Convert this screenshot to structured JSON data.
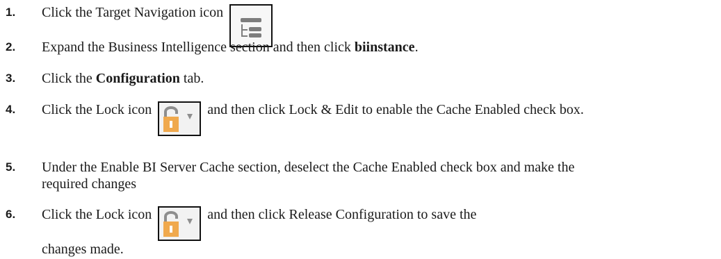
{
  "steps": [
    {
      "num": "1.",
      "text_before": "Click the Target Navigation icon",
      "icon": "target-navigation-icon"
    },
    {
      "num": "2.",
      "text_before": "Expand the Business Intelligence section and then click ",
      "bold": "biinstance",
      "text_after": "."
    },
    {
      "num": "3.",
      "text_before": "Click the ",
      "bold": "Configuration",
      "text_after": " tab."
    },
    {
      "num": "4.",
      "text_before": "Click the Lock icon",
      "icon": "lock-icon",
      "text_after": "and then click Lock & Edit to enable the Cache Enabled check box."
    },
    {
      "num": "5.",
      "text_before": "Under the Enable BI Server Cache section, deselect the Cache Enabled check box and make the required changes"
    },
    {
      "num": "6.",
      "text_before": "Click the Lock icon",
      "icon": "lock-icon",
      "text_after": "and then click Release Configuration to save the changes made."
    }
  ],
  "colors": {
    "lock_body": "#f0a94d",
    "lock_shackle": "#8e8e8e",
    "nav_icon": "#7d7d7d",
    "text": "#1a1a1a"
  }
}
